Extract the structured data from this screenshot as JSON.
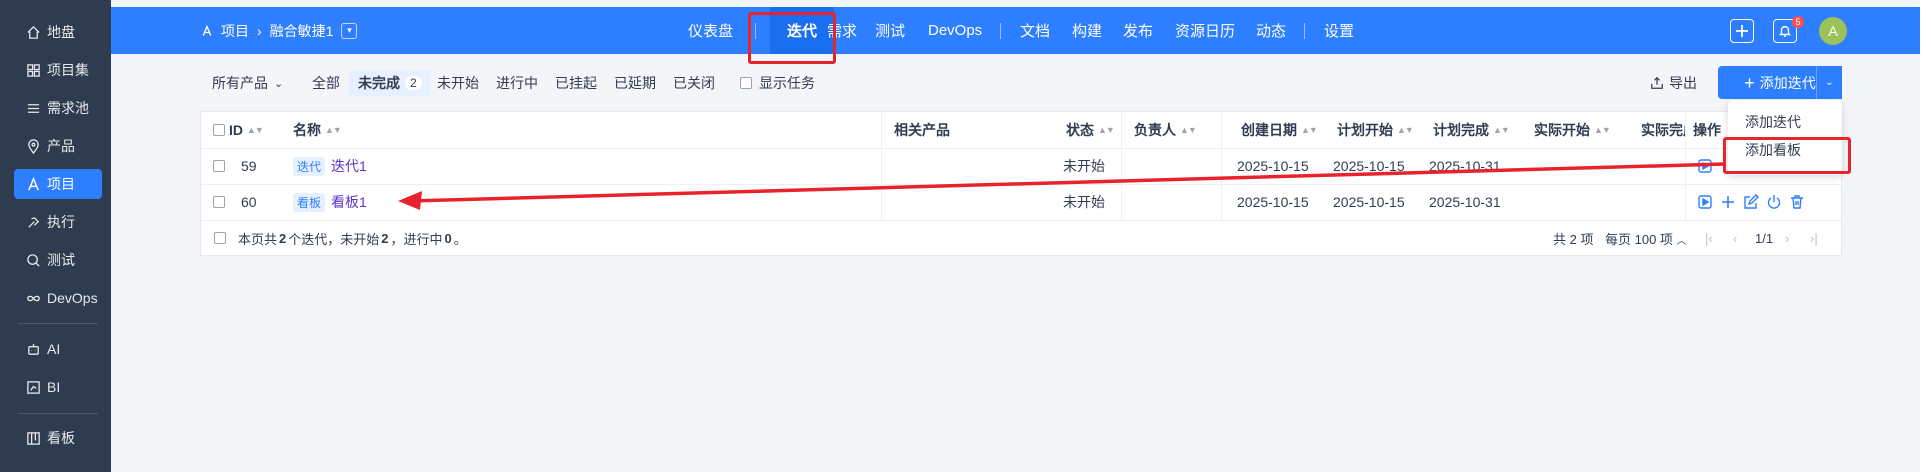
{
  "sidebar": {
    "items": [
      {
        "label": "地盘",
        "icon": "home-icon"
      },
      {
        "label": "项目集",
        "icon": "grid-icon"
      },
      {
        "label": "需求池",
        "icon": "list-icon"
      },
      {
        "label": "产品",
        "icon": "location-icon"
      },
      {
        "label": "项目",
        "icon": "project-icon"
      },
      {
        "label": "执行",
        "icon": "run-icon"
      },
      {
        "label": "测试",
        "icon": "test-icon"
      },
      {
        "label": "DevOps",
        "icon": "infinity-icon"
      },
      {
        "label": "AI",
        "icon": "robot-icon"
      },
      {
        "label": "BI",
        "icon": "chart-icon"
      },
      {
        "label": "看板",
        "icon": "kanban-icon"
      }
    ],
    "active": "项目"
  },
  "topbar": {
    "breadcrumb_root": "项目",
    "breadcrumb_project": "融合敏捷1",
    "nav": [
      "仪表盘",
      "迭代",
      "需求",
      "测试",
      "DevOps",
      "文档",
      "构建",
      "发布",
      "资源日历",
      "动态",
      "设置"
    ],
    "active_nav": "迭代",
    "notification_count": "5",
    "avatar_letter": "A"
  },
  "filters": {
    "product": "所有产品",
    "tabs": [
      "全部",
      "未完成",
      "未开始",
      "进行中",
      "已挂起",
      "已延期",
      "已关闭"
    ],
    "active_tab": "未完成",
    "active_count": "2",
    "show_tasks": "显示任务"
  },
  "toolbar": {
    "export": "导出",
    "add_iteration": "添加迭代"
  },
  "dropdown": {
    "options": [
      "添加迭代",
      "添加看板"
    ]
  },
  "table": {
    "columns": [
      "ID",
      "名称",
      "相关产品",
      "状态",
      "负责人",
      "创建日期",
      "计划开始",
      "计划完成",
      "实际开始",
      "实际完成",
      "操作"
    ],
    "rows": [
      {
        "id": "59",
        "type": "迭代",
        "name": "迭代1",
        "product": "",
        "status": "未开始",
        "owner": "",
        "created": "2025-10-15",
        "plan_start": "2025-10-15",
        "plan_end": "2025-10-31"
      },
      {
        "id": "60",
        "type": "看板",
        "name": "看板1",
        "product": "",
        "status": "未开始",
        "owner": "",
        "created": "2025-10-15",
        "plan_start": "2025-10-15",
        "plan_end": "2025-10-31"
      }
    ]
  },
  "footer": {
    "summary_prefix": "本页共",
    "summary_count": "2",
    "summary_mid": "个迭代，未开始",
    "summary_notstarted": "2",
    "summary_mid2": "，进行中",
    "summary_inprogress": "0",
    "summary_end": "。",
    "total": "共 2 项",
    "per_page": "每页 100 项",
    "page": "1/1"
  },
  "colors": {
    "primary": "#2e7fff",
    "sidebar_bg": "#2f3b4e",
    "annotation_red": "#e8232b"
  }
}
